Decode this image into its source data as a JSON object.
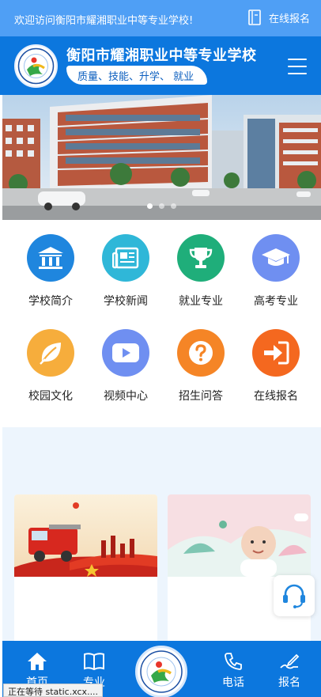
{
  "topbar": {
    "welcome": "欢迎访问衡阳市耀湘职业中等专业学校!",
    "signup_label": "在线报名",
    "signup_icon": "document-icon"
  },
  "header": {
    "school_name": "衡阳市耀湘职业中等专业学校",
    "slogan": "质量、技能、升学、 就业",
    "menu_icon": "hamburger-menu-icon"
  },
  "banner": {
    "slide_count": 3,
    "active_slide": 1
  },
  "grid": {
    "items": [
      {
        "label": "学校简介",
        "icon": "institution-icon",
        "color": "#1f86de"
      },
      {
        "label": "学校新闻",
        "icon": "newspaper-icon",
        "color": "#2fb7d8"
      },
      {
        "label": "就业专业",
        "icon": "trophy-icon",
        "color": "#1fae7a"
      },
      {
        "label": "高考专业",
        "icon": "graduation-cap-icon",
        "color": "#6f8ff1"
      },
      {
        "label": "校园文化",
        "icon": "leaf-icon",
        "color": "#f6ad3c"
      },
      {
        "label": "视频中心",
        "icon": "video-play-icon",
        "color": "#6f8ff1"
      },
      {
        "label": "招生问答",
        "icon": "question-icon",
        "color": "#f58526"
      },
      {
        "label": "在线报名",
        "icon": "sign-in-icon",
        "color": "#f4681f"
      }
    ]
  },
  "bottom_nav": {
    "home": "首页",
    "major": "专业",
    "phone": "电话",
    "signup": "报名"
  },
  "status_bar": "正在等待 static.xcx....",
  "colors": {
    "topbar": "#4f9ff5",
    "header": "#0c77de",
    "lower_bg": "#edf5fd"
  }
}
